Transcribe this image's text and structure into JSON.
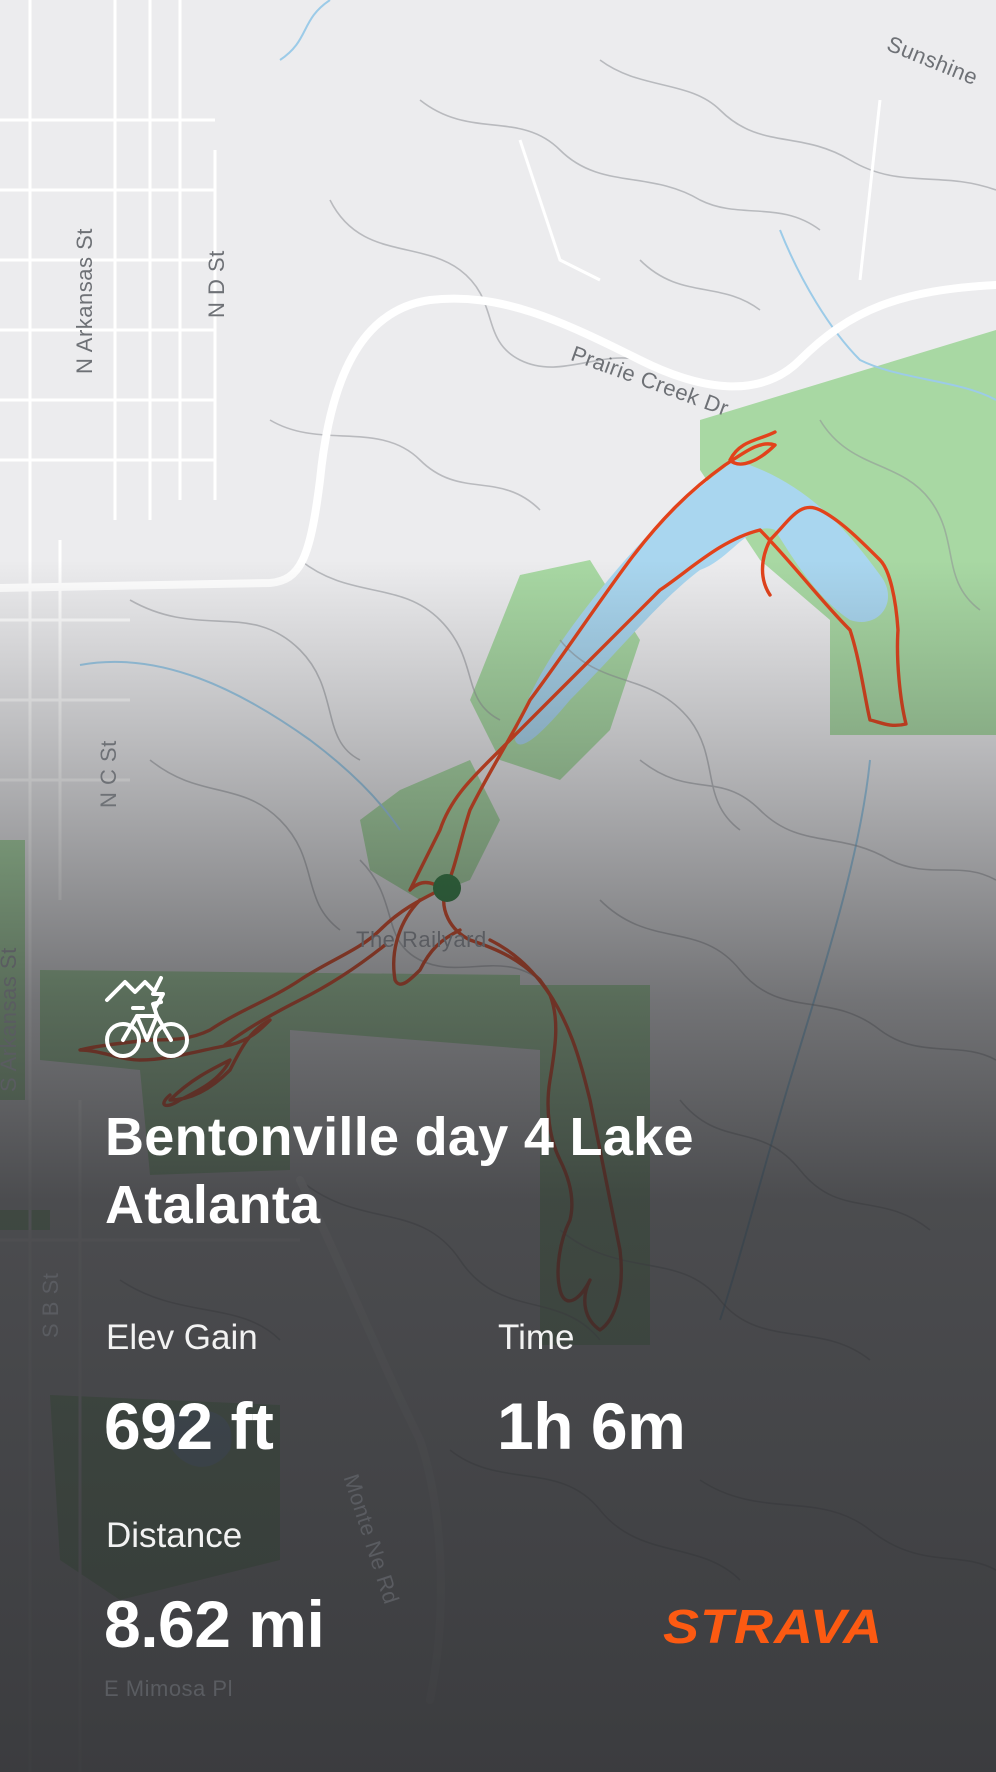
{
  "map": {
    "street_labels": [
      "Sunshine",
      "N Arkansas St",
      "N D St",
      "Prairie Creek Dr",
      "N C St",
      "S Arkansas St",
      "The Railyard",
      "S B St",
      "Monte Ne Rd",
      "E Mimosa Pl"
    ],
    "colors": {
      "base": "#ececee",
      "park": "#a6d9a2",
      "water": "#aad7f0",
      "route": "#e2421b",
      "road": "#ffffff"
    }
  },
  "activity": {
    "icon": "mountain-bike-icon",
    "title": "Bentonville day 4 Lake Atalanta"
  },
  "stats": {
    "elev_gain": {
      "label": "Elev Gain",
      "value": "692 ft"
    },
    "time": {
      "label": "Time",
      "value": "1h 6m"
    },
    "distance": {
      "label": "Distance",
      "value": "8.62 mi"
    }
  },
  "brand": {
    "logo_text": "STRAVA",
    "color": "#fc5a12"
  }
}
